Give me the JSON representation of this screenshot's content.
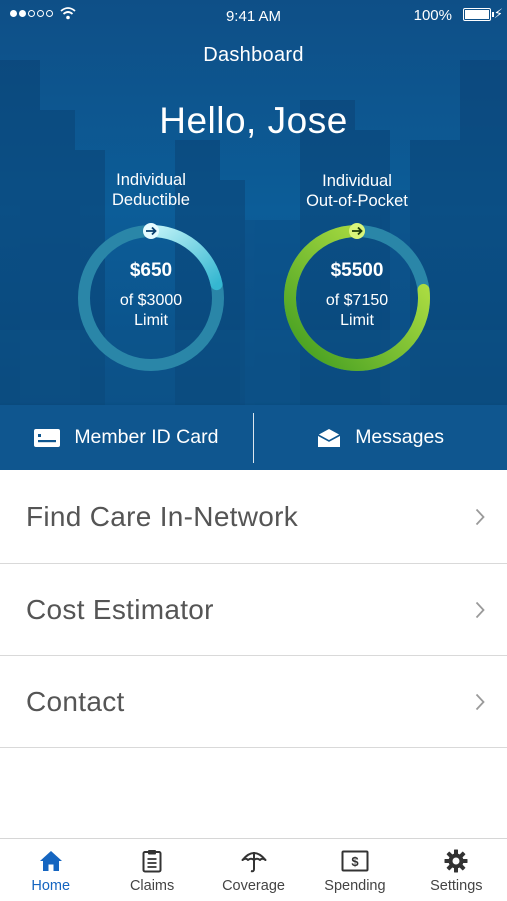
{
  "status_bar": {
    "time": "9:41 AM",
    "battery": "100%"
  },
  "header": {
    "title": "Dashboard",
    "greeting": "Hello, Jose"
  },
  "gauges": [
    {
      "label_line1": "Individual",
      "label_line2": "Deductible",
      "amount": "$650",
      "of_text": "of $3000",
      "limit_text": "Limit",
      "spent": 650,
      "limit": 3000,
      "color_start": "#bff2f7",
      "color_end": "#35b7d1"
    },
    {
      "label_line1": "Individual",
      "label_line2": "Out-of-Pocket",
      "amount": "$5500",
      "of_text": "of $7150",
      "limit_text": "Limit",
      "spent": 5500,
      "limit": 7150,
      "color_start": "#c6ec4a",
      "color_end": "#3d9a1f"
    }
  ],
  "actions": [
    {
      "label": "Member ID Card",
      "icon": "id-card-icon"
    },
    {
      "label": "Messages",
      "icon": "envelope-icon"
    }
  ],
  "menu": [
    {
      "label": "Find Care In-Network"
    },
    {
      "label": "Cost Estimator"
    },
    {
      "label": "Contact"
    }
  ],
  "tabs": [
    {
      "label": "Home",
      "icon": "home-icon",
      "active": true
    },
    {
      "label": "Claims",
      "icon": "clipboard-icon",
      "active": false
    },
    {
      "label": "Coverage",
      "icon": "umbrella-icon",
      "active": false
    },
    {
      "label": "Spending",
      "icon": "dollar-bill-icon",
      "active": false
    },
    {
      "label": "Settings",
      "icon": "gear-icon",
      "active": false
    }
  ],
  "colors": {
    "primary": "#0f568f",
    "accent": "#1565c0",
    "track": "#2a86a8"
  }
}
